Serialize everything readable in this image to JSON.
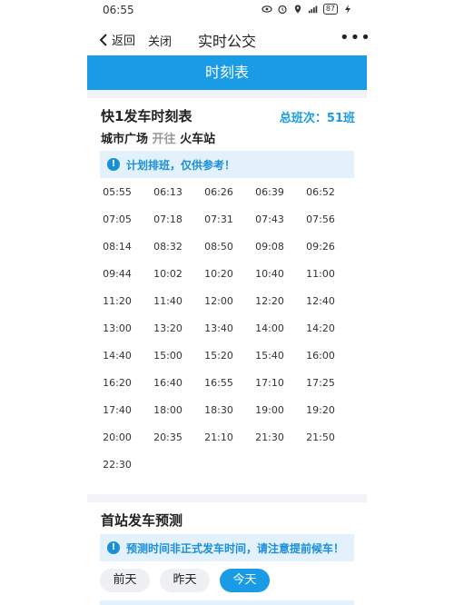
{
  "status_bar": {
    "time": "06:55",
    "battery": "87"
  },
  "title_bar": {
    "back_label": "返回",
    "close_label": "关闭",
    "title": "实时公交",
    "more": "•••"
  },
  "header_band": {
    "label": "时刻表"
  },
  "schedule": {
    "title": "快1发车时刻表",
    "total": "总班次：51班",
    "route_from": "城市广场",
    "route_dir": "开往",
    "route_to": "火车站",
    "notice": "计划排班，仅供参考！",
    "times": [
      "05:55",
      "06:13",
      "06:26",
      "06:39",
      "06:52",
      "07:05",
      "07:18",
      "07:31",
      "07:43",
      "07:56",
      "08:14",
      "08:32",
      "08:50",
      "09:08",
      "09:26",
      "09:44",
      "10:02",
      "10:20",
      "10:40",
      "11:00",
      "11:20",
      "11:40",
      "12:00",
      "12:20",
      "12:40",
      "13:00",
      "13:20",
      "13:40",
      "14:00",
      "14:20",
      "14:40",
      "15:00",
      "15:20",
      "15:40",
      "16:00",
      "16:20",
      "16:40",
      "16:55",
      "17:10",
      "17:25",
      "17:40",
      "18:00",
      "18:30",
      "19:00",
      "19:20",
      "20:00",
      "20:35",
      "21:10",
      "21:30",
      "21:50",
      "22:30"
    ]
  },
  "prediction": {
    "title": "首站发车预测",
    "notice": "预测时间非正式发车时间，请注意提前候车！",
    "tabs": [
      {
        "label": "前天",
        "active": false
      },
      {
        "label": "昨天",
        "active": false
      },
      {
        "label": "今天",
        "active": true
      }
    ]
  },
  "colors": {
    "accent": "#1a9be6",
    "notice_bg": "#e2f1fb"
  }
}
